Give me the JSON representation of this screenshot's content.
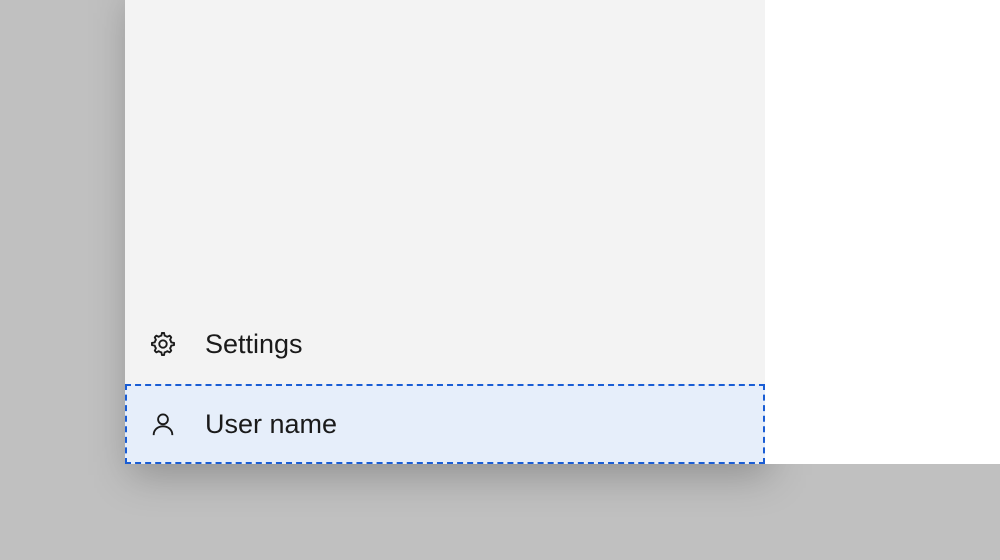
{
  "menu": {
    "settings": {
      "label": "Settings",
      "icon": "gear-icon",
      "selected": false
    },
    "user": {
      "label": "User name",
      "icon": "user-icon",
      "selected": true
    }
  }
}
